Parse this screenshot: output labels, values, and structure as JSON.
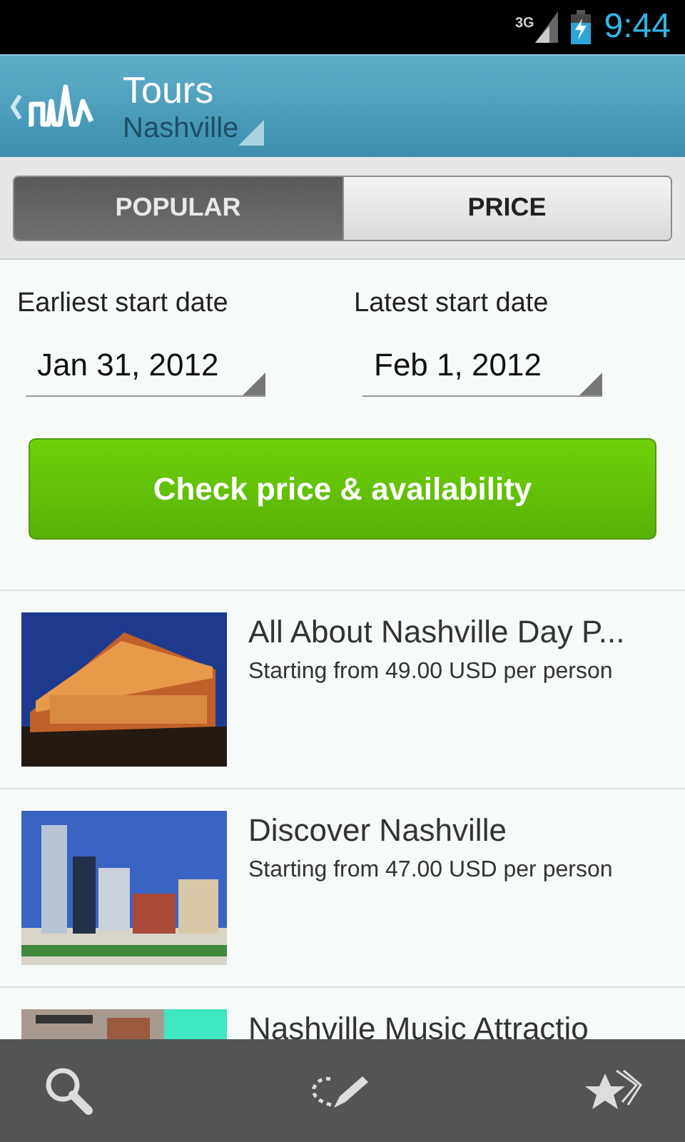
{
  "status_bar": {
    "network": "3G",
    "time": "9:44"
  },
  "header": {
    "title": "Tours",
    "subtitle": "Nashville"
  },
  "tabs": [
    {
      "label": "POPULAR",
      "selected": true
    },
    {
      "label": "PRICE",
      "selected": false
    }
  ],
  "dates": [
    {
      "label": "Earliest start date",
      "value": "Jan 31, 2012"
    },
    {
      "label": "Latest start date",
      "value": "Feb 1, 2012"
    }
  ],
  "check_button": "Check price & availability",
  "tours": [
    {
      "title": "All About Nashville Day P...",
      "price": "Starting from 49.00 USD per person"
    },
    {
      "title": "Discover Nashville",
      "price": "Starting from 47.00 USD per person"
    },
    {
      "title": "Nashville Music Attractio"
    }
  ]
}
